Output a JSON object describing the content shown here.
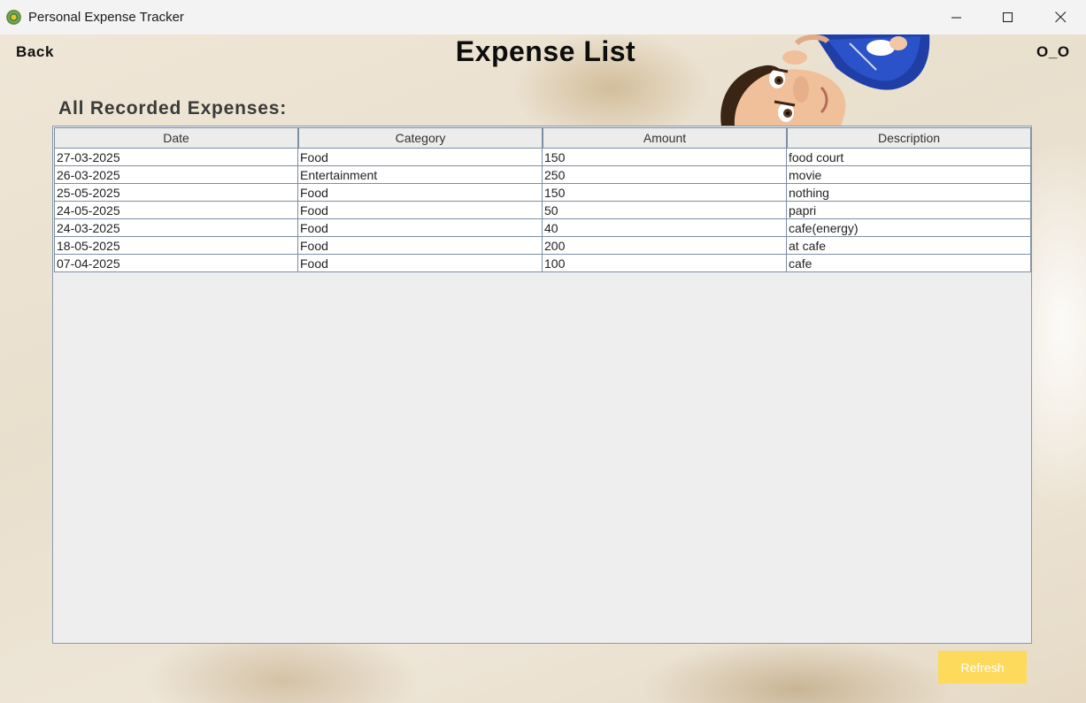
{
  "window": {
    "title": "Personal Expense Tracker",
    "icons": {
      "app": "app-logo-icon",
      "minimize": "minimize-icon",
      "maximize": "maximize-icon",
      "close": "close-icon"
    }
  },
  "header": {
    "back_label": "Back",
    "title": "Expense List",
    "corner_label": "O_O"
  },
  "section": {
    "heading": "All Recorded Expenses:"
  },
  "table": {
    "columns": [
      "Date",
      "Category",
      "Amount",
      "Description"
    ],
    "rows": [
      [
        "27-03-2025",
        "Food",
        "150",
        "food court"
      ],
      [
        "26-03-2025",
        "Entertainment",
        "250",
        "movie"
      ],
      [
        "25-05-2025",
        "Food",
        "150",
        "nothing"
      ],
      [
        "24-05-2025",
        "Food",
        "50",
        "papri"
      ],
      [
        "24-03-2025",
        "Food",
        "40",
        "cafe(energy)"
      ],
      [
        "18-05-2025",
        "Food",
        "200",
        "at cafe"
      ],
      [
        "07-04-2025",
        "Food",
        "100",
        "cafe"
      ]
    ]
  },
  "actions": {
    "refresh_label": "Refresh"
  },
  "colors": {
    "accent_button": "#fdd95c",
    "grid_line": "#7d8ea4",
    "panel_bg": "#eeeeee"
  }
}
